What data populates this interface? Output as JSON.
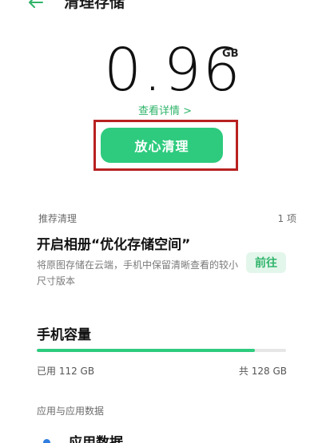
{
  "header": {
    "title": "清理存储",
    "back_icon": "arrow-left-icon"
  },
  "storage": {
    "value": "0.96",
    "unit": "GB",
    "details_link": "查看详情 >"
  },
  "clean_button": {
    "label": "放心清理"
  },
  "recommended": {
    "label": "推荐清理",
    "count": "1 项",
    "item": {
      "title": "开启相册“优化存储空间”",
      "description": "将原图存储在云端，手机中保留清晰查看的较小尺寸版本",
      "action": "前往"
    }
  },
  "capacity": {
    "title": "手机容量",
    "used": "已用 112 GB",
    "total": "共 128 GB",
    "used_fraction": 0.875
  },
  "apps": {
    "label": "应用与应用数据",
    "item_title": "应用数据"
  },
  "colors": {
    "accent": "#2ecb7e",
    "highlight": "#b82121"
  }
}
